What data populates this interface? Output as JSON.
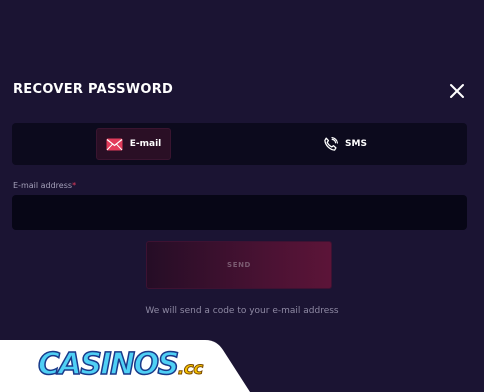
{
  "modal": {
    "title": "RECOVER PASSWORD"
  },
  "tabs": [
    {
      "label": "E-mail",
      "icon": "envelope-icon",
      "active": true
    },
    {
      "label": "SMS",
      "icon": "phone-icon",
      "active": false
    }
  ],
  "form": {
    "email_label": "E-mail address",
    "required_mark": "*",
    "email_value": "",
    "send_label": "SEND",
    "hint": "We will send a code to your e-mail address"
  },
  "watermark": {
    "logo_text": "CASINOS",
    "logo_tld": ".cc"
  },
  "colors": {
    "background": "#1b1433",
    "accent": "#e23c5b",
    "button_gradient_end": "#5c1438"
  }
}
